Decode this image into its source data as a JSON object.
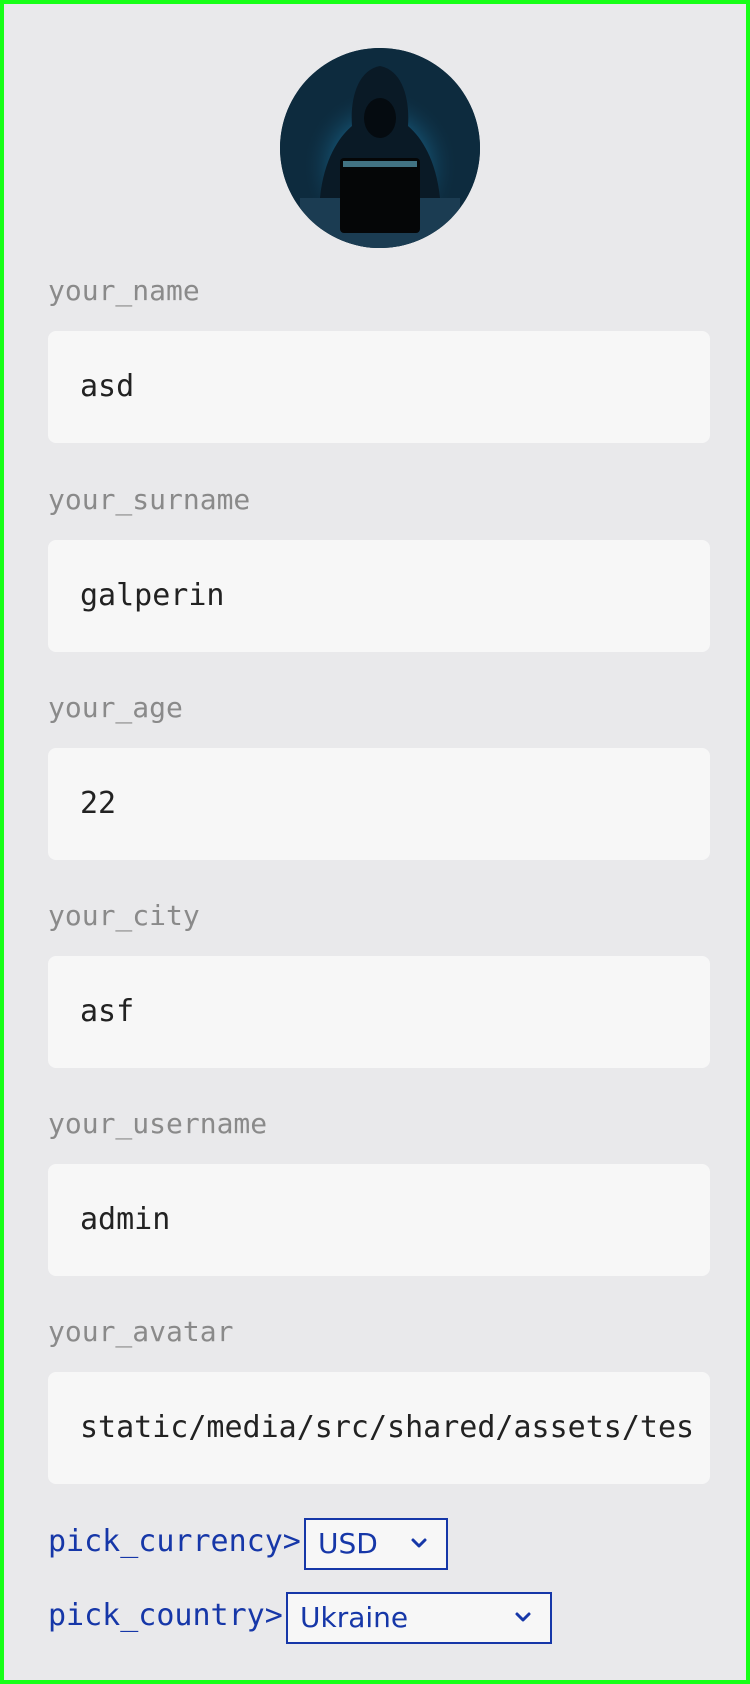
{
  "profile": {
    "avatar_icon": "hooded-hacker-avatar",
    "fields": [
      {
        "label": "your_name",
        "value": "asd"
      },
      {
        "label": "your_surname",
        "value": "galperin"
      },
      {
        "label": "your_age",
        "value": "22"
      },
      {
        "label": "your_city",
        "value": "asf"
      },
      {
        "label": "your_username",
        "value": "admin"
      },
      {
        "label": "your_avatar",
        "value": "static/media/src/shared/assets/tes"
      }
    ]
  },
  "pickers": {
    "currency": {
      "label": "pick_currency>",
      "selected": "USD"
    },
    "country": {
      "label": "pick_country>",
      "selected": "Ukraine"
    }
  },
  "colors": {
    "frame_border": "#17ff17",
    "background": "#e9e9eb",
    "input_background": "#f7f7f7",
    "label_gray": "#8a8a8a",
    "accent_blue": "#1637a8"
  }
}
